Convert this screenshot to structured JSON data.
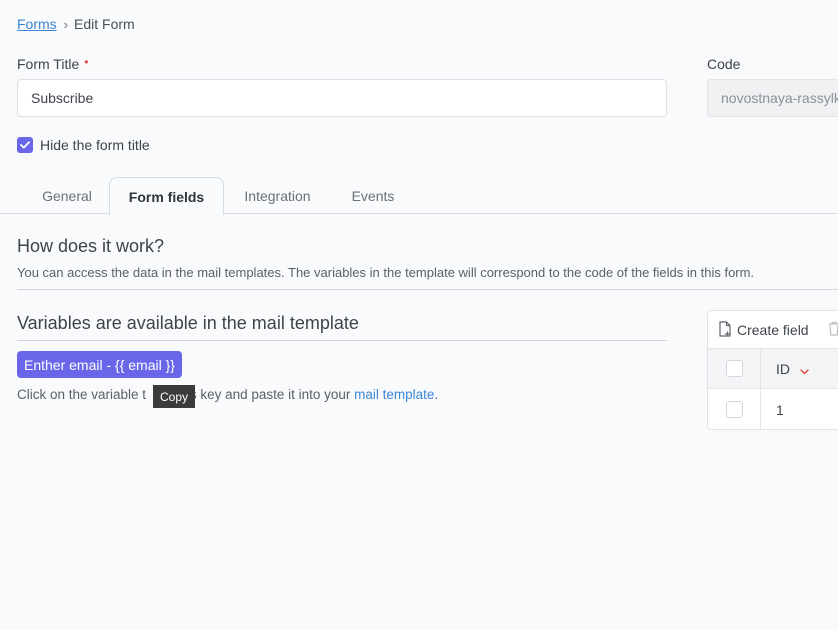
{
  "breadcrumb": {
    "link": "Forms",
    "separator": "›",
    "current": "Edit Form"
  },
  "form": {
    "title_label": "Form Title",
    "required_mark": "•",
    "title_value": "Subscribe",
    "code_label": "Code",
    "code_value": "novostnaya-rassylka",
    "hide_title_label": "Hide the form title",
    "hide_title_checked": true
  },
  "tabs": [
    {
      "label": "General",
      "active": false
    },
    {
      "label": "Form fields",
      "active": true
    },
    {
      "label": "Integration",
      "active": false
    },
    {
      "label": "Events",
      "active": false
    }
  ],
  "how": {
    "heading": "How does it work?",
    "description": "You can access the data in the mail templates. The variables in the template will correspond to the code of the fields in this form."
  },
  "variables": {
    "heading": "Variables are available in the mail template",
    "chip": "Enther email - {{ email }}",
    "hint_before": "Click on the variable t",
    "hint_after": "its key and paste it into your ",
    "hint_link": "mail template",
    "hint_end": ".",
    "tooltip": "Copy"
  },
  "table": {
    "create_label": "Create field",
    "column_id": "ID",
    "rows": [
      {
        "id": "1"
      }
    ]
  },
  "colors": {
    "accent": "#6966ea",
    "link": "#3c86d6",
    "required": "#e5433e"
  }
}
